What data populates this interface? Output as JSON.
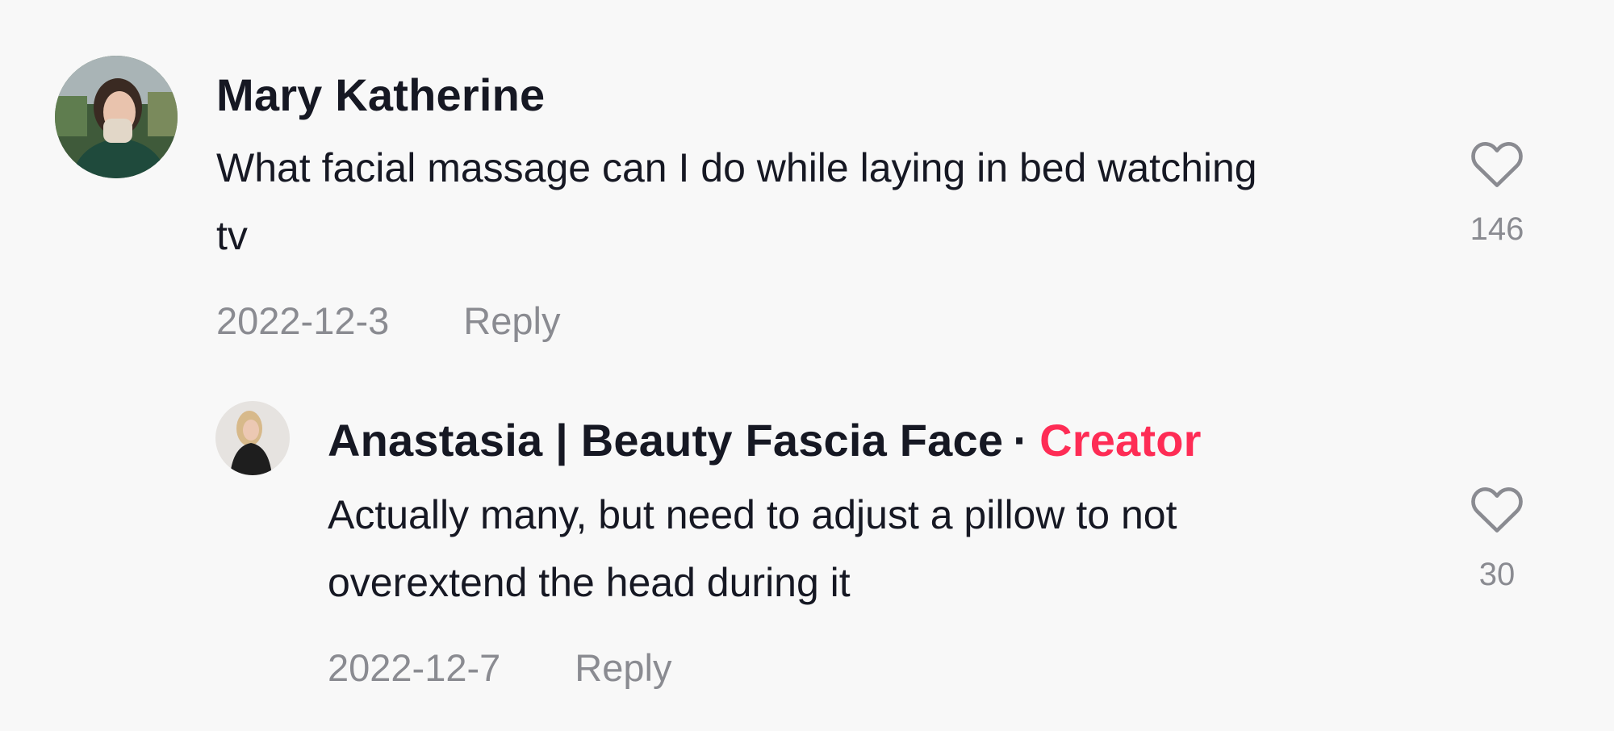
{
  "comments": [
    {
      "username": "Mary Katherine",
      "text": "What facial massage can I do while laying in bed watching tv",
      "date": "2022-12-3",
      "reply_label": "Reply",
      "like_count": "146"
    }
  ],
  "replies": [
    {
      "username": "Anastasia | Beauty Fascia Face",
      "separator": "·",
      "badge": "Creator",
      "text": "Actually many, but need to adjust a pillow to not overextend the head during it",
      "date": "2022-12-7",
      "reply_label": "Reply",
      "like_count": "30"
    }
  ],
  "icons": {
    "like": "heart-outline-icon"
  },
  "colors": {
    "background": "#f8f8f8",
    "text": "#161823",
    "secondary": "#8a8b91",
    "creator_badge": "#fe2c55"
  }
}
